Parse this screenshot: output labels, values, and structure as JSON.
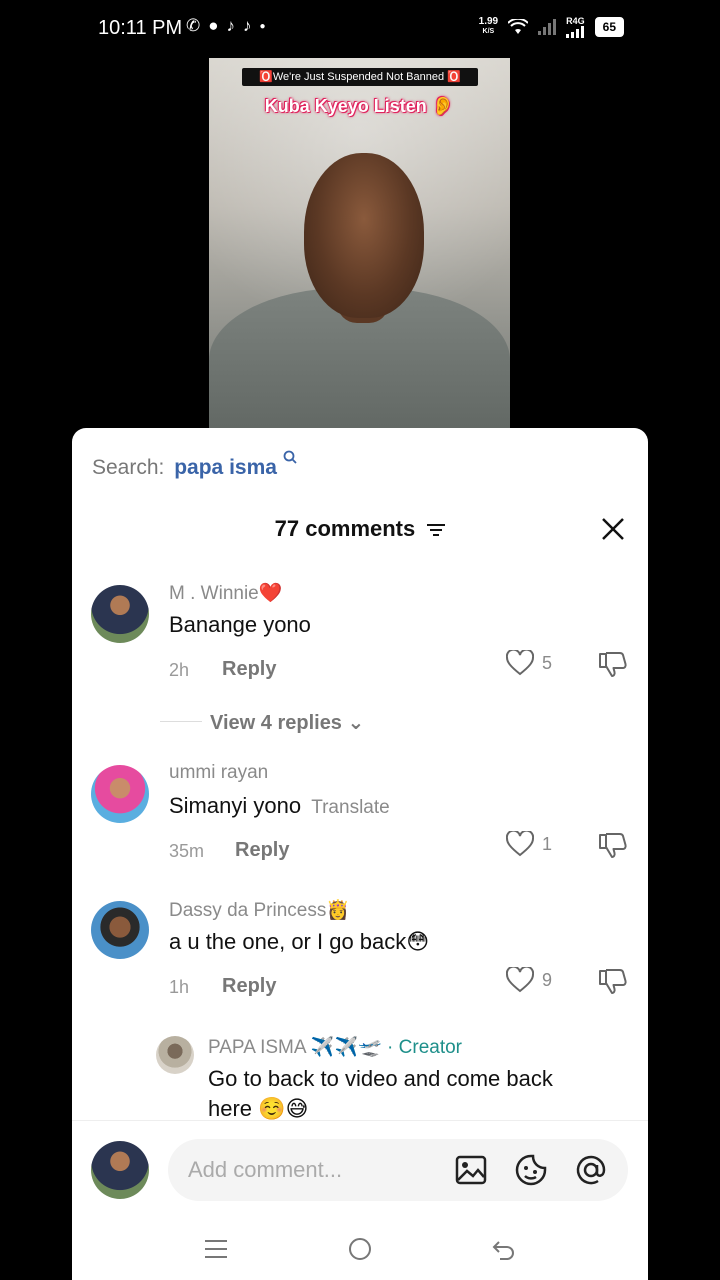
{
  "status_bar": {
    "time": "10:11 PM",
    "net_speed_value": "1.99",
    "net_speed_unit": "K/S",
    "network_type": "R4G",
    "battery": "65"
  },
  "video": {
    "banner": "🅾️We're Just Suspended Not Banned 🅾️",
    "caption": "Kuba Kyeyo Listen 👂"
  },
  "search": {
    "label": "Search:",
    "term": "papa isma"
  },
  "header": {
    "count_label": "77 comments"
  },
  "comments": [
    {
      "name": "M . Winnie❤️",
      "text": "Banange yono",
      "time": "2h",
      "reply_label": "Reply",
      "likes": "5",
      "view_replies": "View 4 replies ⌄"
    },
    {
      "name": "ummi rayan",
      "text": "Simanyi yono",
      "translate": "Translate",
      "time": "35m",
      "reply_label": "Reply",
      "likes": "1"
    },
    {
      "name": "Dassy da Princess👸",
      "text": "a u the one, or I go back😳",
      "time": "1h",
      "reply_label": "Reply",
      "likes": "9"
    }
  ],
  "reply": {
    "name": "PAPA ISMA ✈️✈️🛫",
    "badge": "· Creator",
    "text_line1": "Go to back to video and come back",
    "text_line2": "here ☺️😅"
  },
  "composer": {
    "placeholder": "Add comment..."
  },
  "colors": {
    "accent_blue": "#3a64a8",
    "creator_teal": "#1e8f8a"
  }
}
